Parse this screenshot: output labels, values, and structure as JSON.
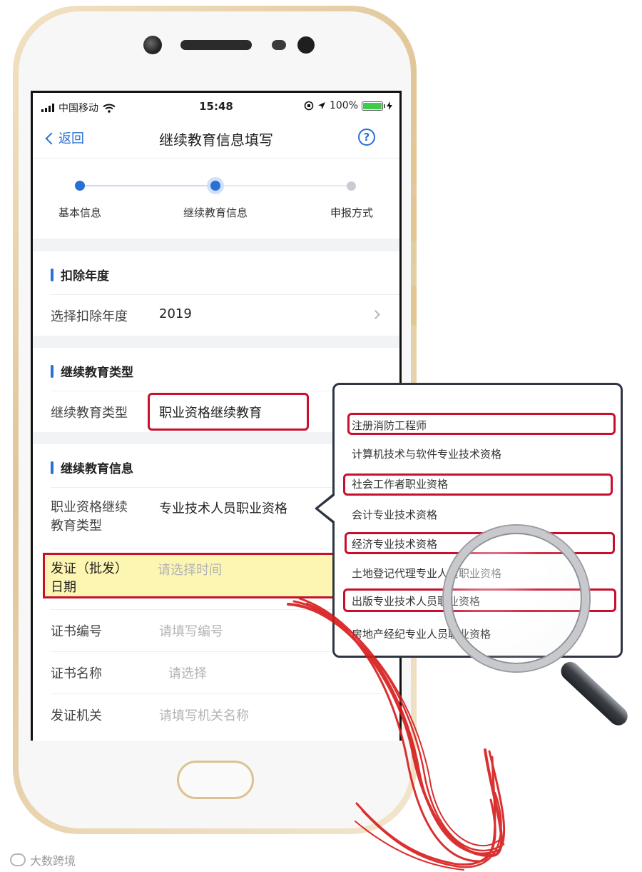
{
  "status_bar": {
    "carrier": "中国移动",
    "time": "15:48",
    "battery": "100%"
  },
  "nav": {
    "back_label": "返回",
    "title": "继续教育信息填写",
    "help_label": "?"
  },
  "steps": [
    {
      "label": "基本信息",
      "state": "done"
    },
    {
      "label": "继续教育信息",
      "state": "current"
    },
    {
      "label": "申报方式",
      "state": "pending"
    }
  ],
  "deduction_year": {
    "heading": "扣除年度",
    "label": "选择扣除年度",
    "value": "2019"
  },
  "edu_type": {
    "heading": "继续教育类型",
    "label": "继续教育类型",
    "value": "职业资格继续教育"
  },
  "edu_info": {
    "heading": "继续教育信息",
    "qual_type_label_1": "职业资格继续",
    "qual_type_label_2": "教育类型",
    "qual_type_value": "专业技术人员职业资格",
    "issue_date_label_1": "发证（批发）",
    "issue_date_label_2": "日期",
    "issue_date_placeholder": "请选择时间",
    "cert_no_label": "证书编号",
    "cert_no_placeholder": "请填写编号",
    "cert_name_label": "证书名称",
    "cert_name_placeholder": "请选择",
    "issuer_label": "发证机关",
    "issuer_placeholder": "请填写机关名称"
  },
  "qualification_options": [
    {
      "label": "注册消防工程师",
      "highlighted": true
    },
    {
      "label": "计算机技术与软件专业技术资格",
      "highlighted": false
    },
    {
      "label": "社会工作者职业资格",
      "highlighted": true
    },
    {
      "label": "会计专业技术资格",
      "highlighted": false
    },
    {
      "label": "经济专业技术资格",
      "highlighted": true
    },
    {
      "label": "土地登记代理专业人员职业资格",
      "highlighted": false
    },
    {
      "label": "出版专业技术人员职业资格",
      "highlighted": true
    },
    {
      "label": "房地产经纪专业人员职业资格",
      "highlighted": false
    }
  ],
  "watermark": "大数跨境",
  "colors": {
    "accent": "#2a6fd6",
    "highlight_red": "#c8102e",
    "highlight_yellow": "#fdf6b2"
  }
}
